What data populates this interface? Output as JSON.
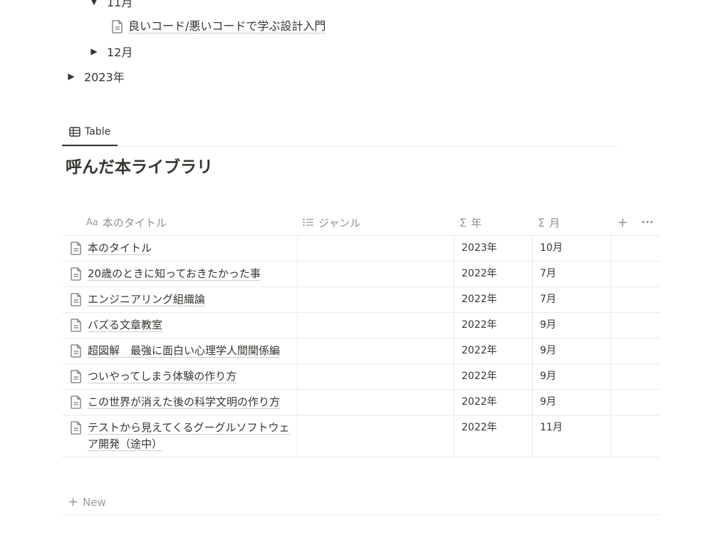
{
  "tree": {
    "month_nov_label": "11月",
    "nov_page_title": "良いコード/悪いコードで学ぶ設計入門",
    "month_dec_label": "12月",
    "year_2023_label": "2023年"
  },
  "view": {
    "tab_label": "Table"
  },
  "database": {
    "title": "呼んだ本ライブラリ",
    "columns": {
      "title": {
        "icon_text": "Aa",
        "label": "本のタイトル"
      },
      "genre": {
        "label": "ジャンル"
      },
      "year": {
        "icon_text": "Σ",
        "label": "年"
      },
      "month": {
        "icon_text": "Σ",
        "label": "月"
      },
      "add_symbol": "+",
      "more_symbol": "···"
    },
    "rows": [
      {
        "title": "本のタイトル",
        "genre": "",
        "year": "2023年",
        "month": "10月"
      },
      {
        "title": "20歳のときに知っておきたかった事",
        "genre": "",
        "year": "2022年",
        "month": "7月"
      },
      {
        "title": "エンジニアリング組織論",
        "genre": "",
        "year": "2022年",
        "month": "7月"
      },
      {
        "title": "バズる文章教室",
        "genre": "",
        "year": "2022年",
        "month": "9月"
      },
      {
        "title": "超図解　最強に面白い心理学人間関係編",
        "genre": "",
        "year": "2022年",
        "month": "9月"
      },
      {
        "title": "ついやってしまう体験の作り方",
        "genre": "",
        "year": "2022年",
        "month": "9月"
      },
      {
        "title": "この世界が消えた後の科学文明の作り方",
        "genre": "",
        "year": "2022年",
        "month": "9月"
      },
      {
        "title": "テストから見えてくるグーグルソフトウェア開発（途中）",
        "genre": "",
        "year": "2022年",
        "month": "11月"
      }
    ],
    "new_label": "New"
  }
}
